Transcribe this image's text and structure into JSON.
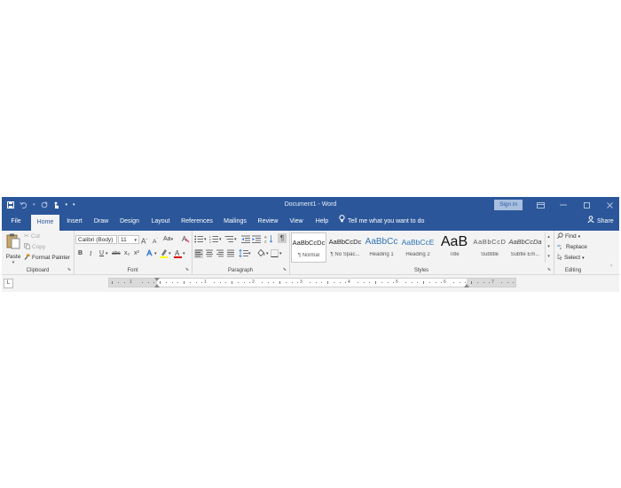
{
  "titlebar": {
    "title": "Document1 - Word",
    "signin": "Sign in"
  },
  "tabs": [
    {
      "label": "File"
    },
    {
      "label": "Home"
    },
    {
      "label": "Insert"
    },
    {
      "label": "Draw"
    },
    {
      "label": "Design"
    },
    {
      "label": "Layout"
    },
    {
      "label": "References"
    },
    {
      "label": "Mailings"
    },
    {
      "label": "Review"
    },
    {
      "label": "View"
    },
    {
      "label": "Help"
    }
  ],
  "active_tab": "Home",
  "tellme": "Tell me what you want to do",
  "share": "Share",
  "clipboard": {
    "paste": "Paste",
    "cut": "Cut",
    "copy": "Copy",
    "format_painter": "Format Painter",
    "label": "Clipboard"
  },
  "font": {
    "name": "Calibri (Body)",
    "size": "11",
    "label": "Font",
    "bold": "B",
    "italic": "I",
    "underline": "U",
    "strike": "abc",
    "sub": "x₂",
    "sup": "x²",
    "grow": "A",
    "shrink": "A",
    "case": "Aa"
  },
  "paragraph": {
    "label": "Paragraph"
  },
  "styles": {
    "label": "Styles",
    "items": [
      {
        "preview": "AaBbCcDc",
        "name": "¶ Normal"
      },
      {
        "preview": "AaBbCcDc",
        "name": "¶ No Spac..."
      },
      {
        "preview": "AaBbCc",
        "name": "Heading 1"
      },
      {
        "preview": "AaBbCcE",
        "name": "Heading 2"
      },
      {
        "preview": "AaB",
        "name": "Title"
      },
      {
        "preview": "AaBbCcD",
        "name": "Subtitle"
      },
      {
        "preview": "AaBbCcDa",
        "name": "Subtle Em..."
      }
    ]
  },
  "editing": {
    "find": "Find",
    "replace": "Replace",
    "select": "Select",
    "label": "Editing"
  },
  "ruler": {
    "numbers": [
      "1",
      "1",
      "2",
      "3",
      "4",
      "5",
      "6",
      "7"
    ],
    "tab_selector": "L"
  },
  "colors": {
    "brand": "#2b579a",
    "highlight": "#ffff00",
    "font_color": "#e00000"
  }
}
